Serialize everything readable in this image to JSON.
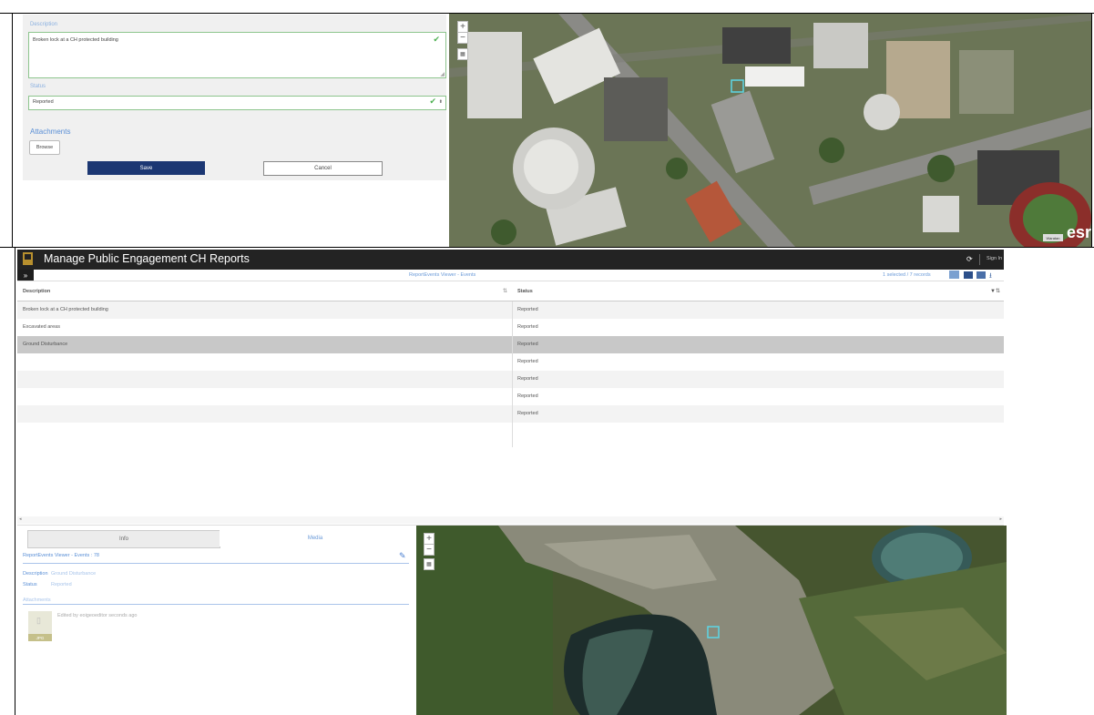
{
  "form": {
    "description_label": "Description",
    "description_value": "Broken lock at a  CH protected building",
    "status_label": "Status",
    "status_value": "Reported",
    "attachments_label": "Attachments",
    "browse_label": "Browse",
    "save_label": "Save",
    "cancel_label": "Cancel"
  },
  "map_top": {
    "zoom_in": "+",
    "zoom_out": "−",
    "esri_label": "esri",
    "attribution_badge": "Waratan"
  },
  "app": {
    "title": "Manage Public Engagement CH Reports",
    "sign_in": "Sign In"
  },
  "toolbar": {
    "layer_name": "ReportEvents Viewer - Events",
    "selection_count": "1 selected / 7 records"
  },
  "table": {
    "headers": [
      "Description",
      "Status"
    ],
    "rows": [
      {
        "description": "Broken lock at a CH protected building",
        "status": "Reported"
      },
      {
        "description": "Excavated areas",
        "status": "Reported"
      },
      {
        "description": "Ground Disturbance",
        "status": "Reported"
      },
      {
        "description": "",
        "status": "Reported"
      },
      {
        "description": "",
        "status": "Reported"
      },
      {
        "description": "",
        "status": "Reported"
      },
      {
        "description": "",
        "status": "Reported"
      }
    ],
    "selected_row_index": 2
  },
  "info": {
    "tabs": [
      "Info",
      "Media"
    ],
    "active_tab": "Info",
    "record_title": "ReportEvents Viewer - Events : 78",
    "description_label": "Description",
    "description_value": "Ground Disturbance",
    "status_label": "Status",
    "status_value": "Reported",
    "attachments_label": "Attachments",
    "attachment_note": "Edited by eoigeoeditor seconds ago",
    "attachment_type": "JPG"
  },
  "map_bottom": {
    "zoom_in": "+",
    "zoom_out": "−"
  },
  "colors": {
    "save_button": "#1c3773",
    "header_bg": "#232323",
    "selected_row": "#c8c8c8",
    "link_blue": "#5a8fd6",
    "selection_marker": "#5cd6e6"
  }
}
